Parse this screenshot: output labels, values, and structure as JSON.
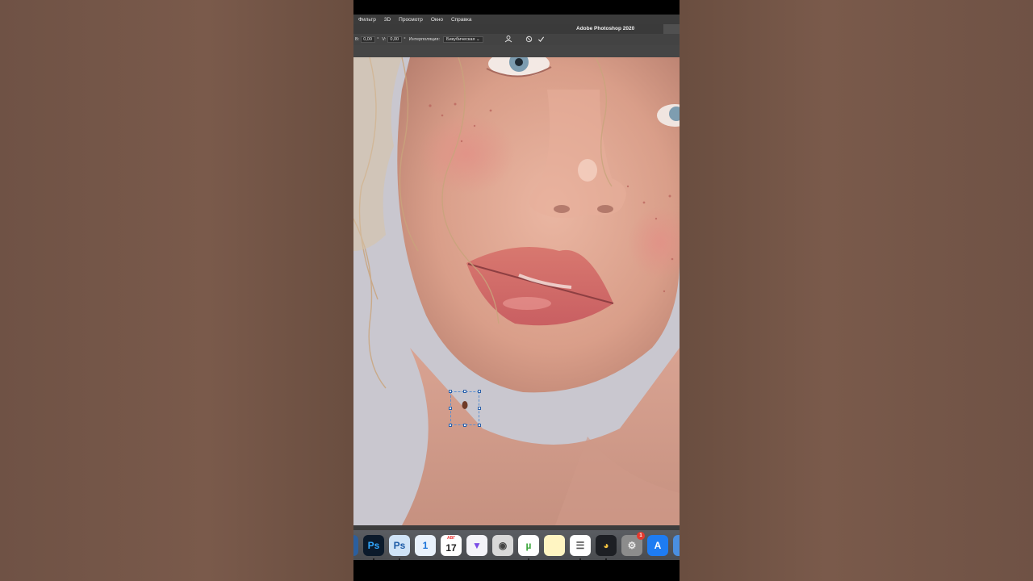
{
  "app": {
    "title": "Adobe Photoshop 2020"
  },
  "menu": {
    "items": [
      "Фильтр",
      "3D",
      "Просмотр",
      "Окно",
      "Справка"
    ]
  },
  "options_bar": {
    "b_label": "В:",
    "b_value": "0,00",
    "b_unit": "°",
    "v_label": "V:",
    "v_value": "0,00",
    "v_unit": "°",
    "interpolation_label": "Интерполяция:",
    "interpolation_value": "Бикубическая ⌄",
    "warp_icon": "warp-icon",
    "cancel_icon": "cancel-icon",
    "commit_icon": "commit-check-icon"
  },
  "dock": {
    "icons": [
      {
        "name": "partial-app-icon",
        "label": "",
        "bg": "#2b5f9e",
        "fg": "#ffffff"
      },
      {
        "name": "photoshop-icon",
        "label": "Ps",
        "bg": "#0b1a2b",
        "fg": "#31a8ff"
      },
      {
        "name": "photoshop-alt-icon",
        "label": "Ps",
        "bg": "#cfe3f7",
        "fg": "#1c5aa6"
      },
      {
        "name": "onepassword-icon",
        "label": "1",
        "bg": "#e8f1fb",
        "fg": "#1a73d9"
      },
      {
        "name": "calendar-icon",
        "label": "17",
        "bg": "#ffffff",
        "fg": "#222222",
        "top": "АВГ"
      },
      {
        "name": "vpn-icon",
        "label": "▼",
        "bg": "#f3f3f8",
        "fg": "#7b4de6"
      },
      {
        "name": "camera-app-icon",
        "label": "◉",
        "bg": "#d8d8d8",
        "fg": "#444444"
      },
      {
        "name": "utorrent-icon",
        "label": "µ",
        "bg": "#ffffff",
        "fg": "#3aa53a"
      },
      {
        "name": "notes-icon",
        "label": "",
        "bg": "#fff5c2",
        "fg": "#f2c200"
      },
      {
        "name": "reminders-icon",
        "label": "☰",
        "bg": "#ffffff",
        "fg": "#555555"
      },
      {
        "name": "davinci-resolve-icon",
        "label": "◕",
        "bg": "#1d1f24",
        "fg": "#f0c040"
      },
      {
        "name": "system-preferences-icon",
        "label": "⚙",
        "bg": "#8c8c8c",
        "fg": "#e8e8e8",
        "badge": "1"
      },
      {
        "name": "app-store-icon",
        "label": "A",
        "bg": "#1e7cf2",
        "fg": "#ffffff"
      },
      {
        "name": "partial-app-icon-right",
        "label": "",
        "bg": "#4a8fe0",
        "fg": "#ffffff"
      }
    ]
  }
}
